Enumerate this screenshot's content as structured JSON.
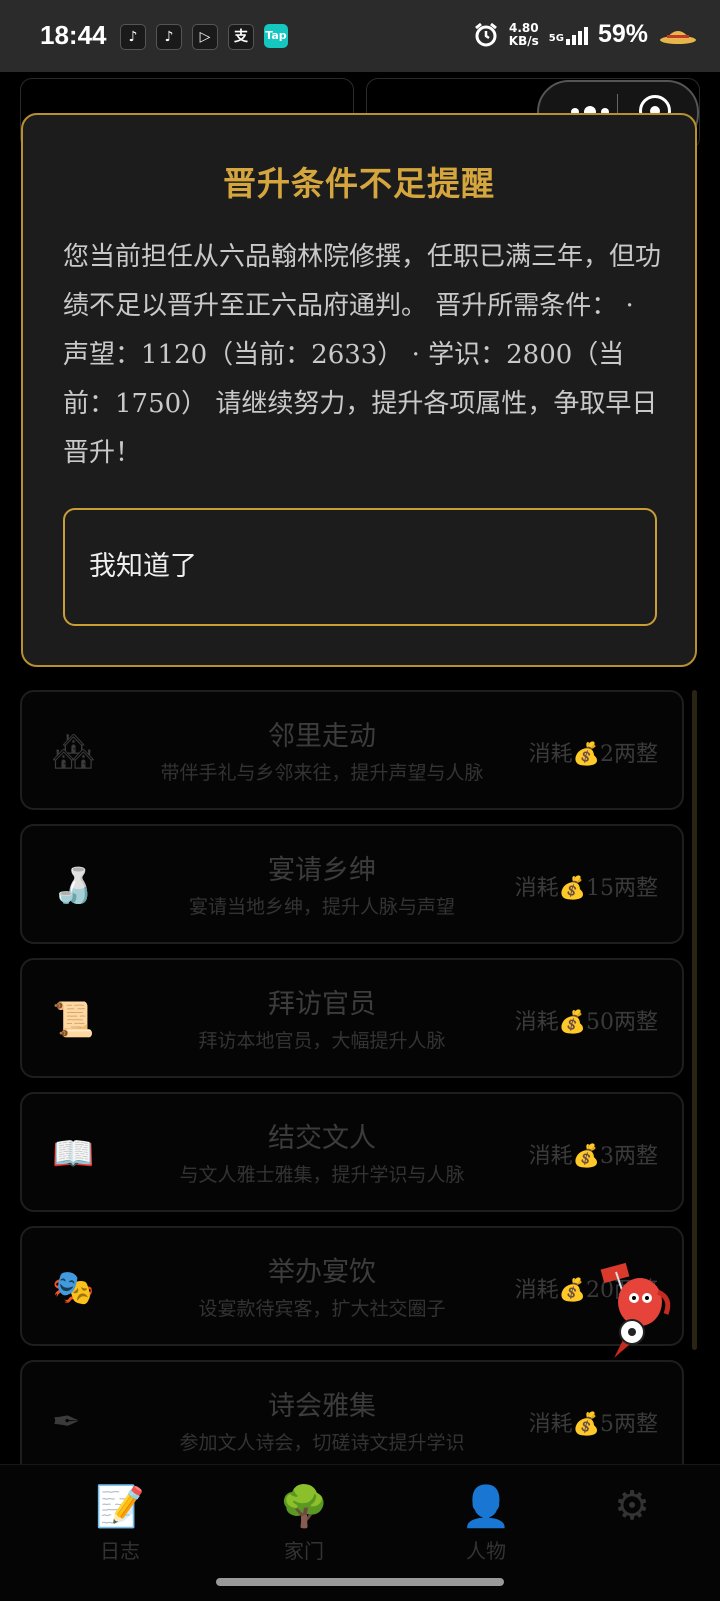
{
  "status_bar": {
    "time": "18:44",
    "app_icons": [
      "music-app-icon",
      "tiktok-icon",
      "video-app-icon",
      "alipay-icon",
      "taptap-icon"
    ],
    "taptap_label": "Tap",
    "net_speed_value": "4.80",
    "net_speed_unit": "KB/s",
    "network": "5G",
    "battery": "59%"
  },
  "capsule": {
    "menu_icon": "more-dots-icon",
    "close_icon": "target-close-icon"
  },
  "modal": {
    "title": "晋升条件不足提醒",
    "body": "您当前担任从六品翰林院修撰，任职已满三年，但功绩不足以晋升至正六品府通判。 晋升所需条件： · 声望：1120（当前：2633） · 学识：2800（当前：1750） 请继续努力，提升各项属性，争取早日晋升！",
    "confirm_label": "我知道了"
  },
  "activities": [
    {
      "icon": "house-icon",
      "glyph": "🏘",
      "title": "邻里走动",
      "desc": "带伴手礼与乡邻来往，提升声望与人脉",
      "cost": "消耗💰2两整"
    },
    {
      "icon": "wine-bottle-icon",
      "glyph": "🍶",
      "title": "宴请乡绅",
      "desc": "宴请当地乡绅，提升人脉与声望",
      "cost": "消耗💰15两整"
    },
    {
      "icon": "scroll-icon",
      "glyph": "📜",
      "title": "拜访官员",
      "desc": "拜访本地官员，大幅提升人脉",
      "cost": "消耗💰50两整"
    },
    {
      "icon": "book-icon",
      "glyph": "📖",
      "title": "结交文人",
      "desc": "与文人雅士雅集，提升学识与人脉",
      "cost": "消耗💰3两整"
    },
    {
      "icon": "mask-icon",
      "glyph": "🎭",
      "title": "举办宴饮",
      "desc": "设宴款待宾客，扩大社交圈子",
      "cost": "消耗💰20两整"
    },
    {
      "icon": "pen-icon",
      "glyph": "✒",
      "title": "诗会雅集",
      "desc": "参加文人诗会，切磋诗文提升学识",
      "cost": "消耗💰5两整"
    }
  ],
  "bottom_nav": [
    {
      "icon": "journal-icon",
      "glyph": "📝",
      "label": "日志"
    },
    {
      "icon": "tree-icon",
      "glyph": "🌳",
      "label": "家门"
    },
    {
      "icon": "person-icon",
      "glyph": "👤",
      "label": "人物"
    },
    {
      "icon": "gear-icon",
      "glyph": "⚙",
      "label": ""
    }
  ],
  "mascot": {
    "icon": "mascot-football-icon"
  },
  "colors": {
    "accent_gold": "#d6a63e",
    "border_gold": "#b8902f",
    "modal_bg": "#1c1c1c",
    "page_bg": "#000000"
  }
}
